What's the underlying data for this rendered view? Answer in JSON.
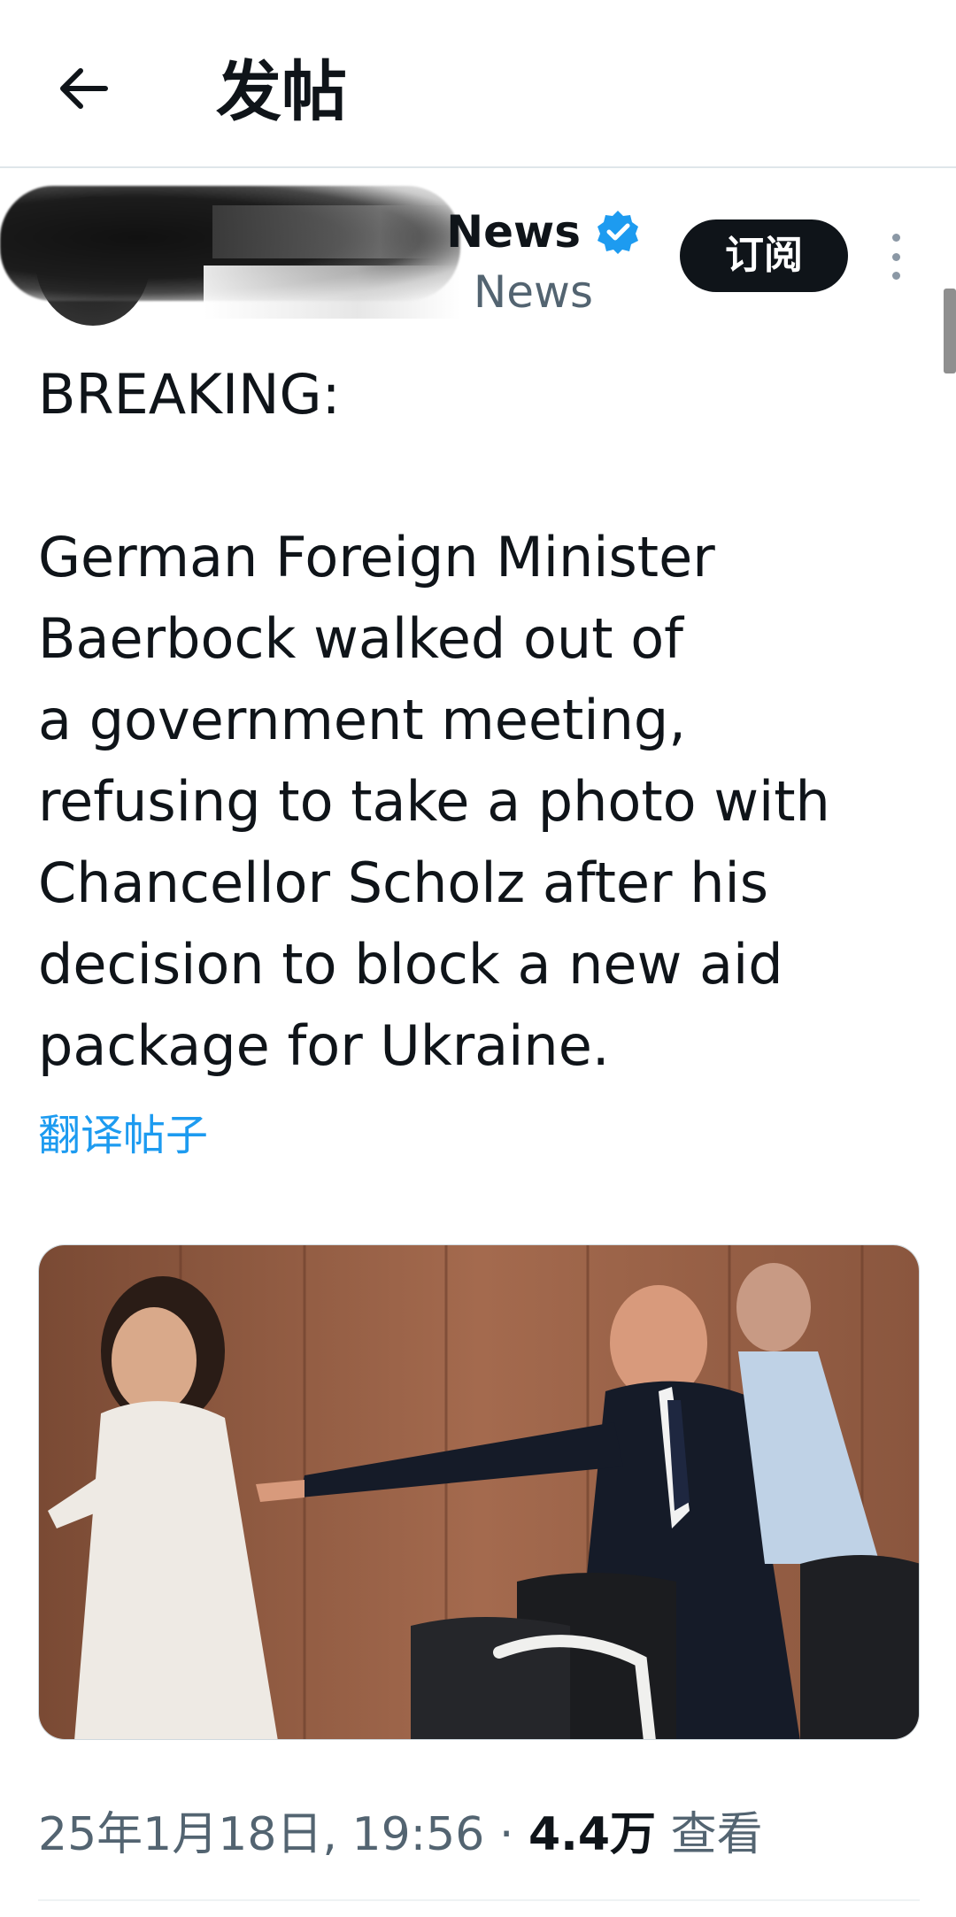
{
  "header": {
    "title": "发帖"
  },
  "author": {
    "name_visible": "News",
    "handle_visible": "News",
    "verified": true,
    "subscribe_label": "订阅"
  },
  "post": {
    "text": "BREAKING:\n\nGerman Foreign Minister\nBaerbock walked out of\na government meeting,\nrefusing to take a photo with\nChancellor Scholz after his\ndecision to block a new aid\npackage for Ukraine.",
    "translate_label": "翻译帖子"
  },
  "meta": {
    "timestamp": "25年1月18日, 19:56",
    "separator": " · ",
    "views_count": "4.4万",
    "views_label": " 查看"
  },
  "colors": {
    "accent": "#1d9bf0",
    "text": "#0f1419",
    "secondary": "#536471"
  },
  "icons": {
    "back": "arrow-left-icon",
    "verified": "verified-badge-icon",
    "more": "more-vertical-icon"
  }
}
